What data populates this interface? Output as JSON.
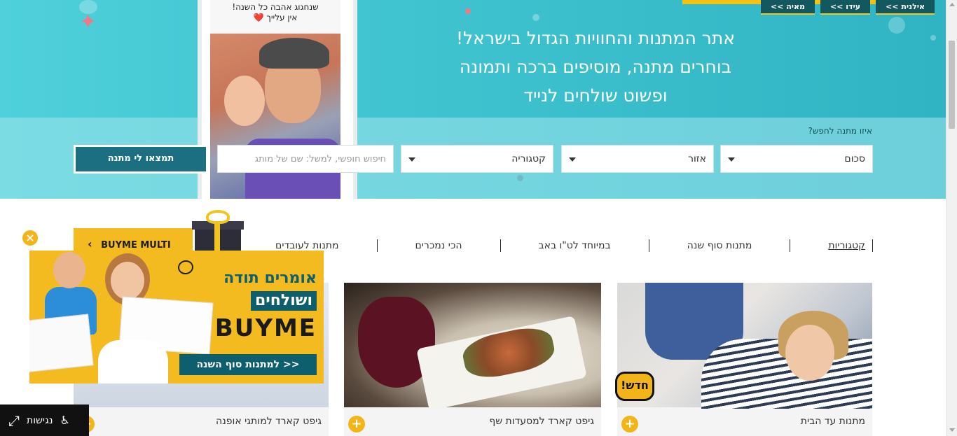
{
  "hero": {
    "tagline_line1": "אתר המתנות והחוויות הגדול בישראל!",
    "tagline_line2": "בוחרים מתנה, מוסיפים ברכה ותמונה",
    "tagline_line3": "ופשוט שולחים לנייד",
    "phone_caption_line1": "שנחגוג אהבה כל השנה!",
    "phone_caption_line2": "אין עלייך ❤️",
    "top_tabs": [
      "<< מאיה",
      "<< עידו",
      "<< אילנית"
    ]
  },
  "search": {
    "label": "איזו מתנה לחפש?",
    "amount_value": "סכום",
    "region_value": "אזור",
    "category_value": "קטגוריה",
    "free_search_placeholder": "חיפוש חופשי, למשל: שם של מותג",
    "submit_label": "תמצאו לי מתנה"
  },
  "catnav": {
    "items": [
      "קטגוריות",
      "מתנות סוף שנה",
      "במיוחד לט\"ו באב",
      "הכי נמכרים",
      "מתנות לעובדים"
    ],
    "multi_label": "BUYME MULTI"
  },
  "cards": [
    {
      "title": "מתנות עד הבית",
      "badge": "חדש!"
    },
    {
      "title": "גיפט קארד למסעדות שף"
    },
    {
      "title": "גיפט קארד למותגי אופנה"
    }
  ],
  "promo": {
    "line1": "אומרים תודה",
    "line2": "ושולחים",
    "brand": "BUYME",
    "cta": "<< למתנות סוף השנה",
    "close": "×"
  },
  "accessibility": {
    "label": "נגישות"
  },
  "colors": {
    "hero_teal": "#3fc3cf",
    "button_teal": "#1c6f80",
    "accent_yellow": "#f3bb20",
    "promo_teal": "#0e5f6d"
  },
  "icons": [
    "chevron-left-icon",
    "gift-icon",
    "plus-icon",
    "close-icon",
    "expand-icon",
    "wheelchair-icon",
    "dropdown-caret-icon"
  ]
}
